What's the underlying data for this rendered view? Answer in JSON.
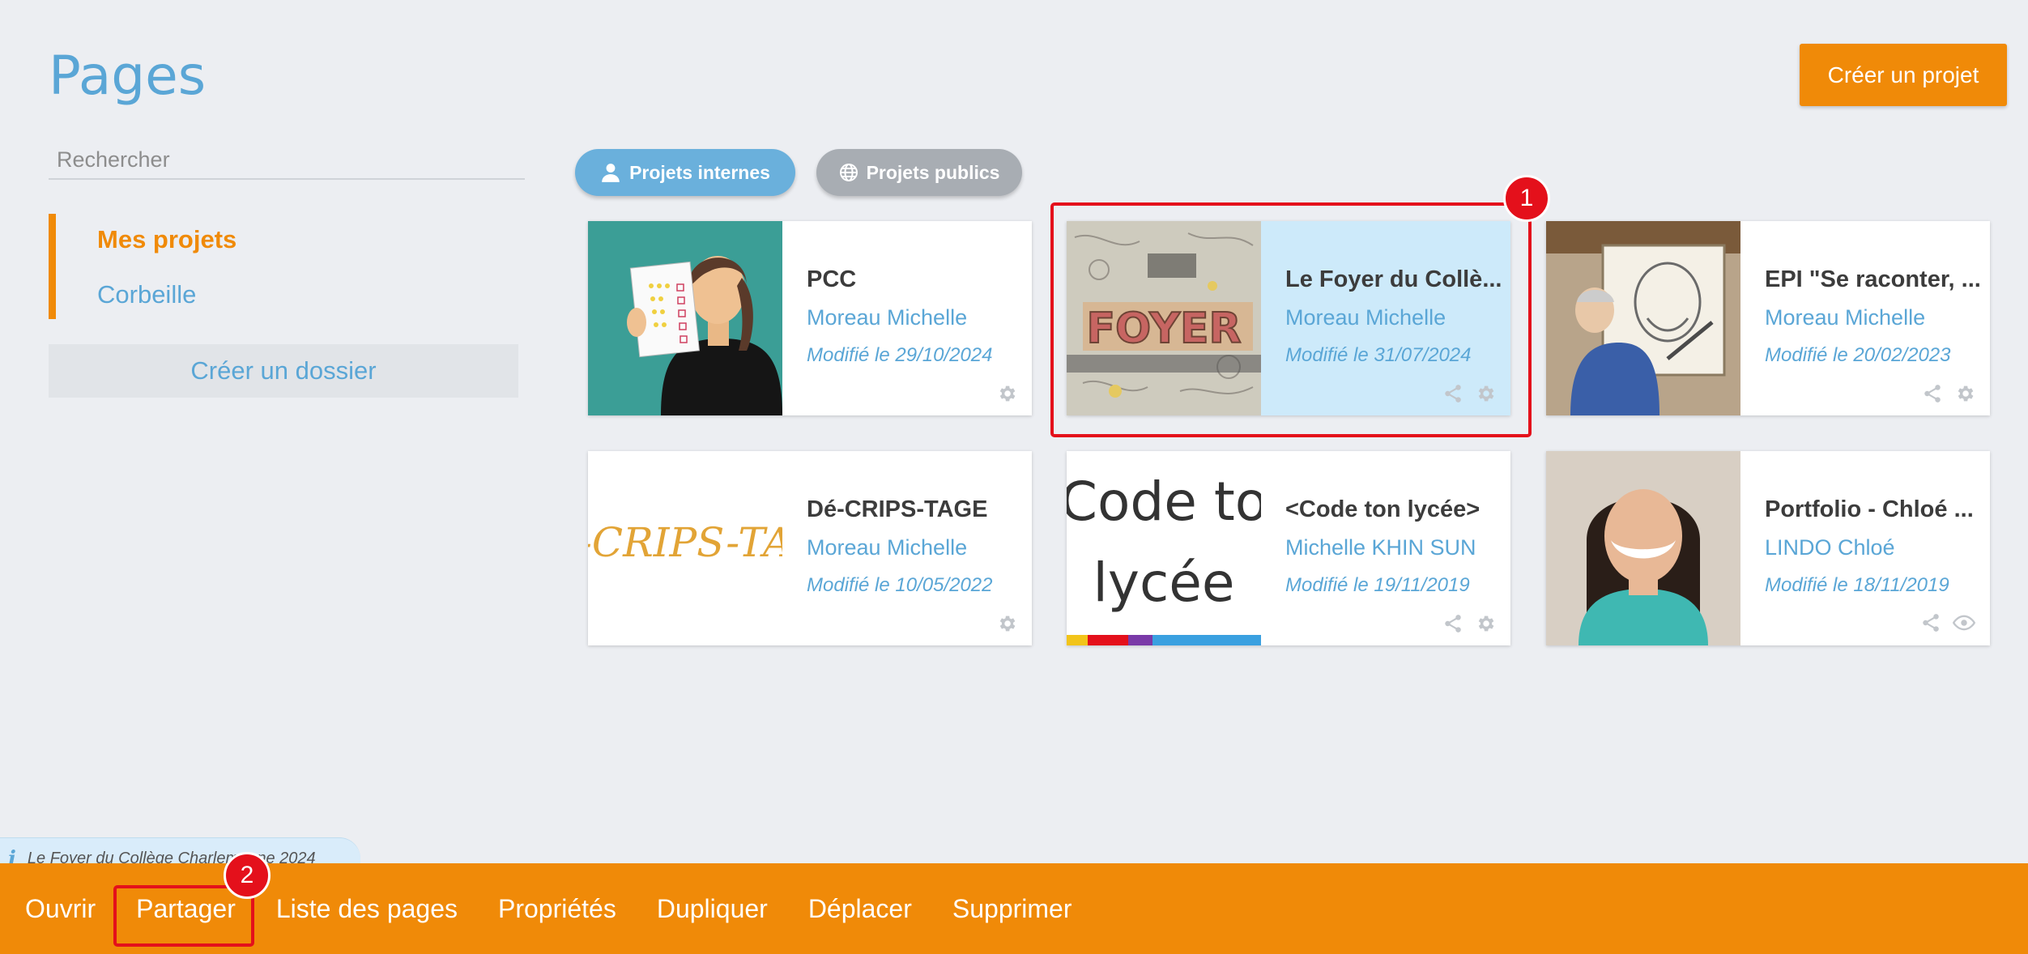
{
  "header": {
    "title": "Pages",
    "create_project_label": "Créer un projet"
  },
  "sidebar": {
    "search_placeholder": "Rechercher",
    "items": [
      {
        "label": "Mes projets",
        "active": true
      },
      {
        "label": "Corbeille",
        "active": false
      }
    ],
    "create_folder_label": "Créer un dossier"
  },
  "filters": {
    "internal_label": "Projets internes",
    "public_label": "Projets publics"
  },
  "cards": [
    {
      "title": "PCC",
      "author": "Moreau Michelle",
      "date": "Modifié le 29/10/2024",
      "icons": [
        "gear-icon"
      ]
    },
    {
      "title": "Le Foyer du Collè...",
      "author": "Moreau Michelle",
      "date": "Modifié le 31/07/2024",
      "icons": [
        "share-icon",
        "gear-icon"
      ],
      "selected": true
    },
    {
      "title": "EPI \"Se raconter, ...",
      "author": "Moreau Michelle",
      "date": "Modifié le 20/02/2023",
      "icons": [
        "share-icon",
        "gear-icon"
      ]
    },
    {
      "title": "Dé-CRIPS-TAGE",
      "author": "Moreau Michelle",
      "date": "Modifié le 10/05/2022",
      "icons": [
        "gear-icon"
      ],
      "thumb_text": "-CRIPS-TA"
    },
    {
      "title": "<Code ton lycée>",
      "author": "Michelle KHIN SUN",
      "date": "Modifié le 19/11/2019",
      "icons": [
        "share-icon",
        "gear-icon"
      ],
      "thumb_line1": "Code to",
      "thumb_line2": "lycée"
    },
    {
      "title": "Portfolio - Chloé ...",
      "author": "LINDO Chloé",
      "date": "Modifié le 18/11/2019",
      "icons": [
        "share-icon",
        "eye-icon"
      ]
    }
  ],
  "annotations": {
    "marker1": "1",
    "marker2": "2"
  },
  "info_bar": {
    "text": "Le Foyer du Collège Charlemagne 2024"
  },
  "toolbar": {
    "open": "Ouvrir",
    "share": "Partager",
    "page_list": "Liste des pages",
    "properties": "Propriétés",
    "duplicate": "Dupliquer",
    "move": "Déplacer",
    "delete": "Supprimer"
  },
  "colors": {
    "accent": "#f08a08",
    "link": "#5aa6d6",
    "selected_card": "#cdeafa",
    "annotation": "#e4101b"
  }
}
